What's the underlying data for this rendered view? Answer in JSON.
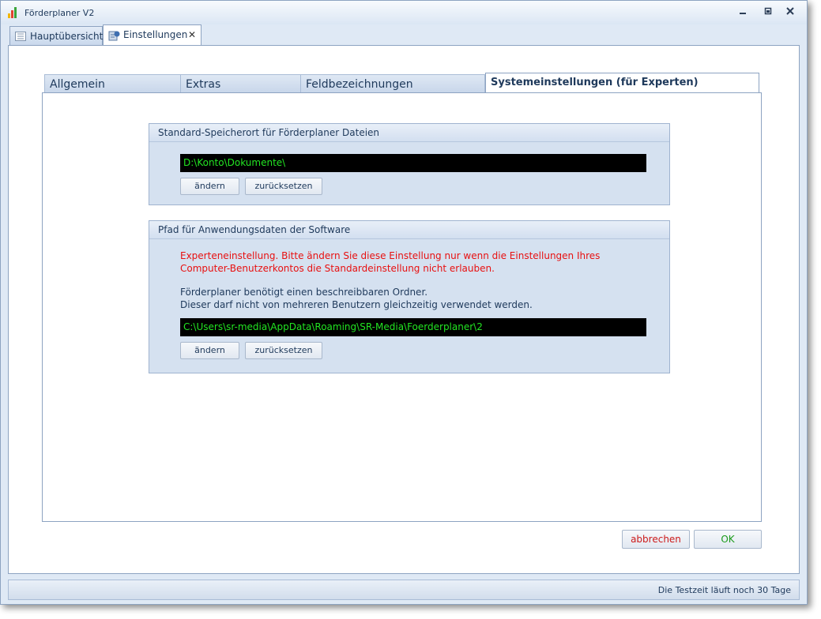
{
  "window": {
    "title": "Förderplaner V2"
  },
  "doc_tabs": [
    {
      "label": "Hauptübersicht",
      "icon": "list-icon"
    },
    {
      "label": "Einstellungen",
      "icon": "settings-icon",
      "close": "✕"
    }
  ],
  "settings_tabs": [
    {
      "label": "Allgemein"
    },
    {
      "label": "Extras"
    },
    {
      "label": "Feldbezeichnungen"
    },
    {
      "label": "Systemeinstellungen (für Experten)"
    }
  ],
  "storage_group": {
    "title": "Standard-Speicherort für Förderplaner Dateien",
    "path": "D:\\Konto\\Dokumente\\",
    "change_label": "ändern",
    "reset_label": "zurücksetzen"
  },
  "appdata_group": {
    "title": "Pfad für Anwendungsdaten der Software",
    "warning_line1": "Experteneinstellung. Bitte ändern Sie diese Einstellung nur wenn die Einstellungen Ihres",
    "warning_line2": "Computer-Benutzerkontos die Standardeinstellung nicht erlauben.",
    "info_line1": "Förderplaner benötigt einen beschreibbaren Ordner.",
    "info_line2": "Dieser darf nicht von mehreren Benutzern gleichzeitig verwendet werden.",
    "path": "C:\\Users\\sr-media\\AppData\\Roaming\\SR-Media\\Foerderplaner\\2",
    "change_label": "ändern",
    "reset_label": "zurücksetzen"
  },
  "footer": {
    "cancel_label": "abbrechen",
    "ok_label": "OK"
  },
  "status": {
    "text": "Die Testzeit läuft noch 30 Tage"
  },
  "colors": {
    "path_bg": "#000000",
    "path_text": "#22e422",
    "warning": "#e81010",
    "cancel_text": "#cc1a1a",
    "ok_text": "#1a9a1a"
  }
}
